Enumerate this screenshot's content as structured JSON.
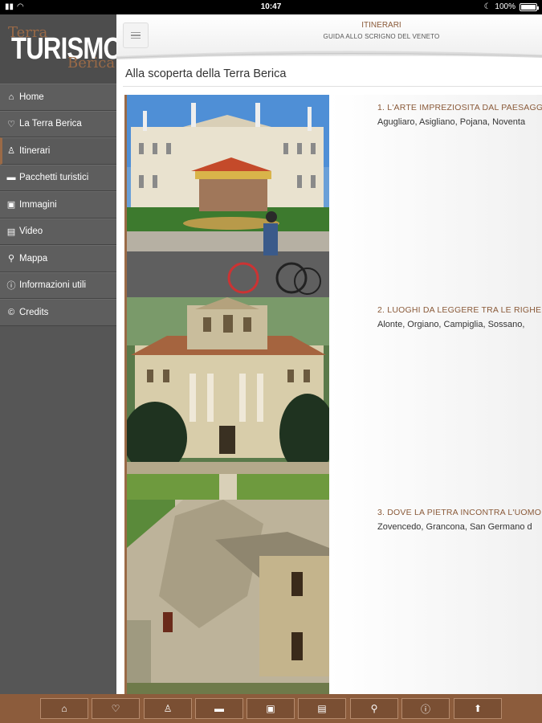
{
  "status": {
    "time": "10:47",
    "battery": "100%"
  },
  "logo": {
    "terra": "Terra",
    "turismo": "TURISMO",
    "berica": "Berica"
  },
  "menu": [
    {
      "icon": "home-icon",
      "label": "Home"
    },
    {
      "icon": "heart-icon",
      "label": "La Terra Berica"
    },
    {
      "icon": "hiker-icon",
      "label": "Itinerari"
    },
    {
      "icon": "bed-icon",
      "label": "Pacchetti turistici"
    },
    {
      "icon": "image-icon",
      "label": "Immagini"
    },
    {
      "icon": "film-icon",
      "label": "Video"
    },
    {
      "icon": "map-marker-icon",
      "label": "Mappa"
    },
    {
      "icon": "info-icon",
      "label": "Informazioni utili"
    },
    {
      "icon": "copyright-icon",
      "label": "Credits"
    }
  ],
  "header": {
    "title": "ITINERARI",
    "subtitle": "GUIDA ALLO SCRIGNO DEL VENETO"
  },
  "section_title": "Alla scoperta della Terra Berica",
  "itineraries": [
    {
      "title": "1. L'ARTE IMPREZIOSITA DAL PAESAGG",
      "places": "Agugliaro, Asigliano, Pojana, Noventa"
    },
    {
      "title": "2. LUOGHI DA LEGGERE TRA LE RIGHE",
      "places": "Alonte, Orgiano, Campiglia, Sossano,"
    },
    {
      "title": "3. DOVE LA PIETRA INCONTRA L'UOMO",
      "places": "Zovencedo, Grancona, San Germano d"
    }
  ],
  "bottom_icons": [
    "home-icon",
    "heart-icon",
    "hiker-icon",
    "bed-icon",
    "image-icon",
    "film-icon",
    "map-marker-icon",
    "info-icon",
    "arrow-up-icon"
  ],
  "colors": {
    "accent": "#9a6a47",
    "sidebar": "#565656",
    "bottom_bar": "#8c5c3c"
  }
}
